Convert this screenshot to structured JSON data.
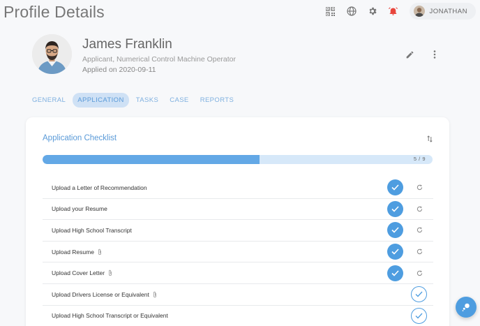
{
  "header": {
    "title": "Profile Details",
    "icons": [
      "qr-code-icon",
      "globe-icon",
      "gear-icon",
      "alarm-icon"
    ],
    "user": {
      "name": "JONATHAN"
    }
  },
  "profile": {
    "name": "James Franklin",
    "role": "Applicant, Numerical Control Machine Operator",
    "applied": "Applied on 2020-09-11"
  },
  "tabs": [
    {
      "label": "GENERAL",
      "active": false
    },
    {
      "label": "APPLICATION",
      "active": true
    },
    {
      "label": "TASKS",
      "active": false
    },
    {
      "label": "CASE",
      "active": false
    },
    {
      "label": "REPORTS",
      "active": false
    }
  ],
  "checklist": {
    "title": "Application Checklist",
    "progress_text": "5 / 9",
    "progress_fraction": 0.5556,
    "items": [
      {
        "label": "Upload a Letter of Recommendation",
        "done": true,
        "attachment": false
      },
      {
        "label": "Upload your Resume",
        "done": true,
        "attachment": false
      },
      {
        "label": "Upload High School Transcript",
        "done": true,
        "attachment": false
      },
      {
        "label": "Upload Resume",
        "done": true,
        "attachment": true
      },
      {
        "label": "Upload Cover Letter",
        "done": true,
        "attachment": true
      },
      {
        "label": "Upload Drivers License or Equivalent",
        "done": false,
        "attachment": true
      },
      {
        "label": "Upload High School Transcript or Equivalent",
        "done": false,
        "attachment": false
      }
    ]
  },
  "colors": {
    "accent": "#4e9de0",
    "alarm": "#e8453c",
    "progress_track": "#d6e8f9"
  }
}
